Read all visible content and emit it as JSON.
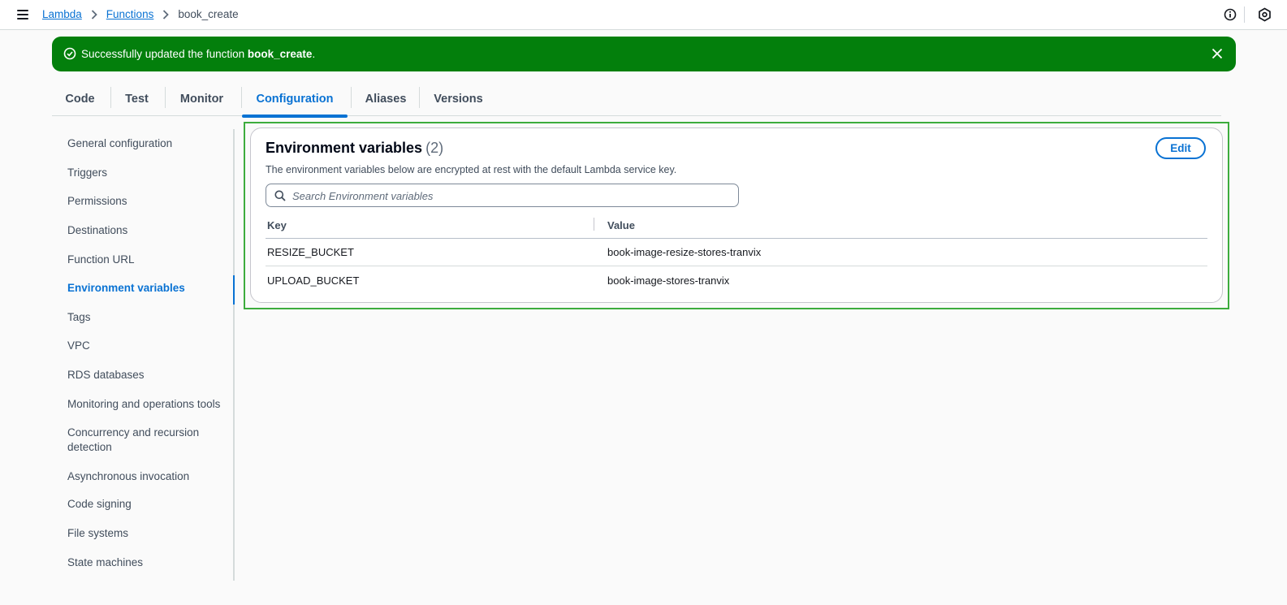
{
  "breadcrumb": {
    "items": [
      "Lambda",
      "Functions"
    ],
    "current": "book_create"
  },
  "flash": {
    "message_prefix": "Successfully updated the function ",
    "function_name": "book_create",
    "message_suffix": ".",
    "status_color": "#037f0c"
  },
  "tabs": [
    {
      "label": "Code",
      "active": false
    },
    {
      "label": "Test",
      "active": false
    },
    {
      "label": "Monitor",
      "active": false
    },
    {
      "label": "Configuration",
      "active": true
    },
    {
      "label": "Aliases",
      "active": false
    },
    {
      "label": "Versions",
      "active": false
    }
  ],
  "sidenav": {
    "items": [
      "General configuration",
      "Triggers",
      "Permissions",
      "Destinations",
      "Function URL",
      "Environment variables",
      "Tags",
      "VPC",
      "RDS databases",
      "Monitoring and operations tools",
      "Concurrency and recursion detection",
      "Asynchronous invocation",
      "Code signing",
      "File systems",
      "State machines"
    ],
    "active": "Environment variables"
  },
  "env": {
    "title": "Environment variables",
    "count": "(2)",
    "description": "The environment variables below are encrypted at rest with the default Lambda service key.",
    "edit_label": "Edit",
    "search_placeholder": "Search Environment variables",
    "columns": [
      "Key",
      "Value"
    ],
    "rows": [
      {
        "key": "RESIZE_BUCKET",
        "value": "book-image-resize-stores-tranvix"
      },
      {
        "key": "UPLOAD_BUCKET",
        "value": "book-image-stores-tranvix"
      }
    ]
  },
  "colors": {
    "accent": "#0972d3",
    "highlight_border": "#3dac3d"
  },
  "icons": [
    "menu-icon",
    "chevron-right-icon",
    "info-icon",
    "settings-hex-icon",
    "success-check-icon",
    "close-icon",
    "search-icon"
  ]
}
